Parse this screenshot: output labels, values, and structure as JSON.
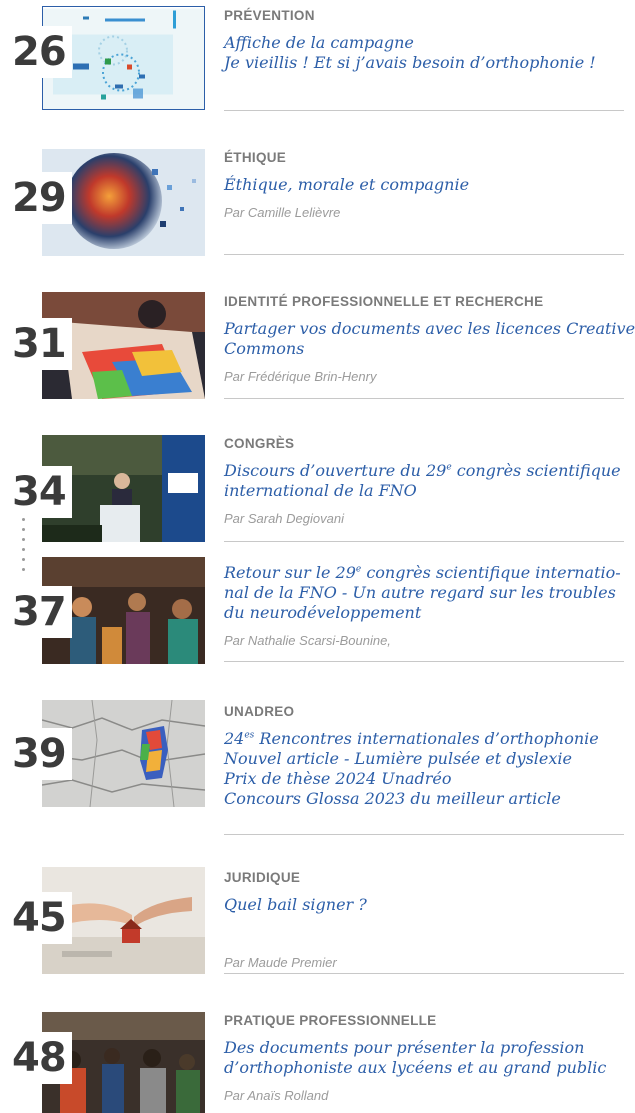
{
  "entries": [
    {
      "num": "26",
      "category": "PRÉVENTION",
      "title_lines": [
        "Affiche de la campagne",
        "Je vieillis ! Et si j’avais besoin d’orthophonie !"
      ],
      "author": ""
    },
    {
      "num": "29",
      "category": "ÉTHIQUE",
      "title_lines": [
        "Éthique, morale et compagnie"
      ],
      "author": "Par Camille Lelièvre"
    },
    {
      "num": "31",
      "category": "IDENTITÉ PROFESSIONNELLE ET RECHERCHE",
      "title_lines": [
        "Partager vos documents avec les licences Creative",
        "Commons"
      ],
      "author": "Par Frédérique Brin-Henry"
    },
    {
      "num": "34",
      "category": "CONGRÈS",
      "title_pre": "Discours d’ouverture du 29",
      "title_sup": "e",
      "title_post": " congrès scientifique",
      "title_line2": "international de la FNO",
      "author": "Par Sarah Degiovani"
    },
    {
      "num": "37",
      "category": "",
      "title_pre": "Retour sur le 29",
      "title_sup": "e",
      "title_post": " congrès scientifique interna­tio-",
      "title_line2": "nal de la FNO - Un autre regard sur les troubles",
      "title_line3": "du neurodéveloppement",
      "author": "Par Nathalie Scarsi-Bounine,"
    },
    {
      "num": "39",
      "category": "UNADREO",
      "title_pre": "24",
      "title_sup": "es",
      "title_post": " Rencontres internationales d’orthophonie",
      "title_lines_extra": [
        "Nouvel article - Lumière pulsée et dyslexie",
        "Prix de thèse 2024 Unadréo",
        "Concours Glossa 2023 du meilleur article"
      ],
      "author": ""
    },
    {
      "num": "45",
      "category": "JURIDIQUE",
      "title_lines": [
        "Quel bail signer ?"
      ],
      "author": "Par Maude Premier"
    },
    {
      "num": "48",
      "category": "PRATIQUE PROFESSIONNELLE",
      "title_lines": [
        "Des documents pour présenter la profession",
        "d’orthophoniste aux lycéens et au grand public"
      ],
      "author": "Par Anaïs Rolland"
    }
  ],
  "colors": {
    "title": "#2c5ea8",
    "category": "#7a7a7a",
    "author": "#9b9b9b",
    "number": "#3b3b3b",
    "rule": "#c8c8c8"
  }
}
